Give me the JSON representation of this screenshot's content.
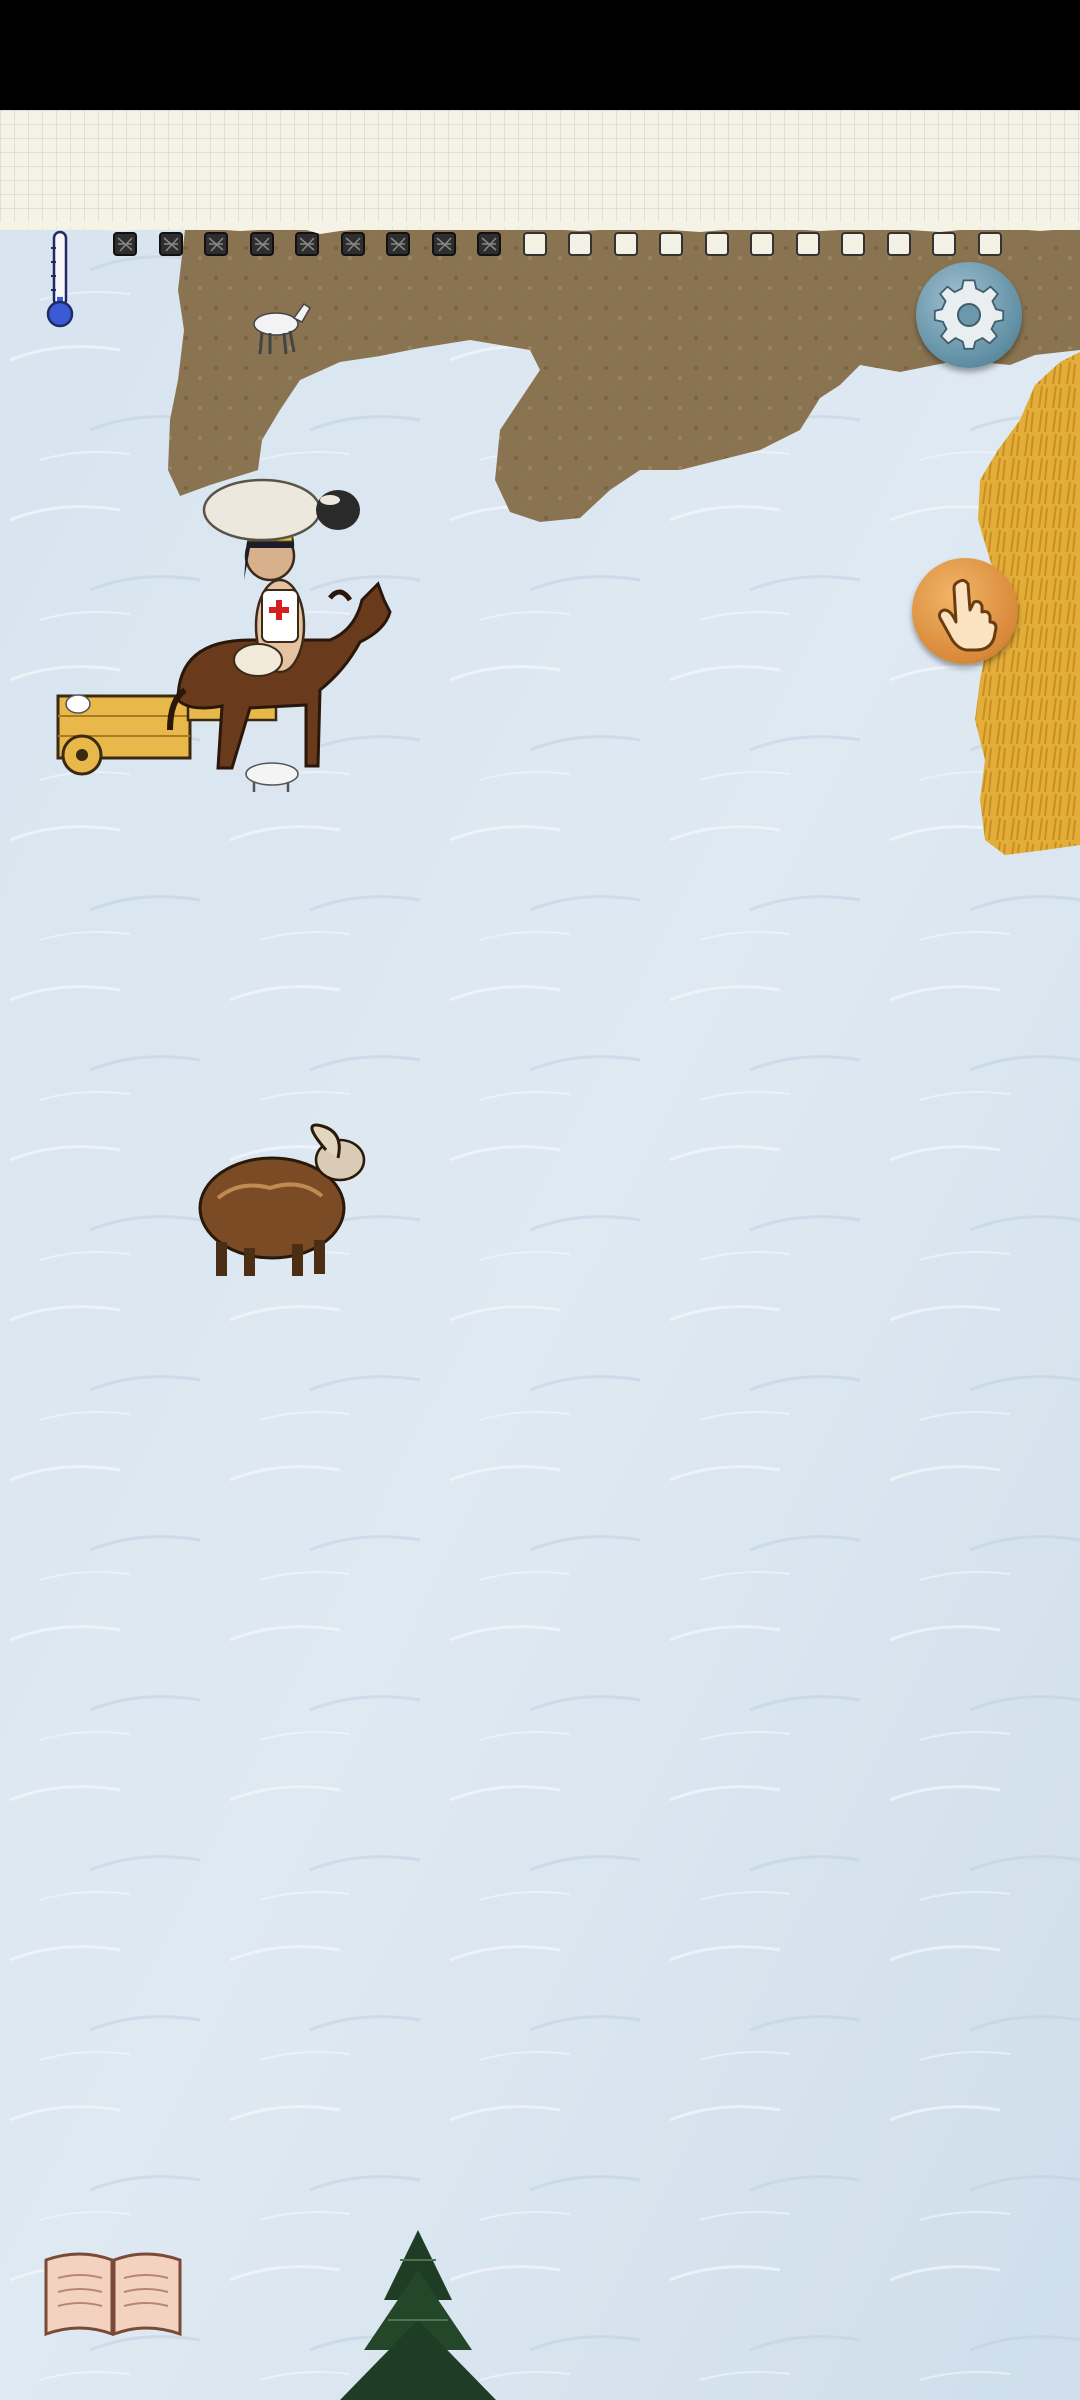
{
  "hud": {
    "temperature_level": 0.15,
    "food_meter": {
      "total_pips": 20,
      "filled_pips": 9
    }
  },
  "icons": {
    "temperature": "thermometer-icon",
    "settings": "gear-icon",
    "interact": "hand-pointer-icon",
    "journal": "open-book-icon"
  },
  "colors": {
    "snow": "#dbe7f1",
    "dirt": "#8a7350",
    "wheat": "#e3ad3a",
    "settings_button": "#6b98ad",
    "interact_button": "#dd8d3c",
    "cold_blue": "#3b5bd6"
  },
  "world": {
    "entities": [
      "player-on-horse",
      "wooden-cart",
      "carried-sheep",
      "lamb",
      "goat-kid",
      "mouflon-ram",
      "pine-tree"
    ]
  }
}
